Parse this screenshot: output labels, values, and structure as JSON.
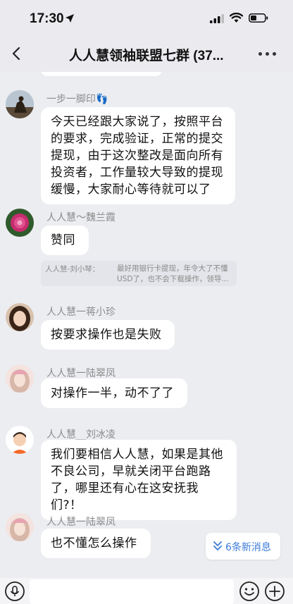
{
  "status": {
    "time": "17:30"
  },
  "header": {
    "title": "人人慧领袖联盟七群 (37...",
    "back_icon": "chevron-left-icon",
    "more_icon": "more-dots-icon"
  },
  "messages": [
    {
      "sender": "一步一脚印👣",
      "lines": [
        "今天已经跟大家说了，按照平台",
        "的要求，完成验证，正常的提交",
        "提现，由于这次整改是面向所有",
        "投资者，工作量较大导致的提现",
        "缓慢，大家耐心等待就可以了"
      ]
    },
    {
      "sender": "人人慧～魏兰霞",
      "lines": [
        "赞同"
      ]
    },
    {
      "sender": "人人慧一蒋小珍",
      "lines": [
        "按要求操作也是失败"
      ]
    },
    {
      "sender": "人人慧一陆翠凤",
      "lines": [
        "对操作一半，动不了了"
      ]
    },
    {
      "sender": "人人慧__刘冰凌",
      "lines": [
        "我们要相信人人慧，如果是其他",
        "不良公司，早就关闭平台跑路",
        "了，哪里还有心在这安抚我们?！"
      ]
    },
    {
      "sender": "人人慧一陆翠凤",
      "lines": [
        "也不懂怎么操作"
      ]
    }
  ],
  "quote": {
    "name": "人人慧-刘小琴：",
    "lines": [
      "最好用银行卡提现，年令大了不懂",
      "USD了，也不会下载操作，领导..."
    ]
  },
  "new_messages": {
    "label": "6条新消息",
    "icon": "double-chevron-down-icon"
  },
  "input_bar": {
    "voice_icon": "voice-icon",
    "emoji_icon": "emoji-icon",
    "plus_icon": "plus-icon"
  }
}
